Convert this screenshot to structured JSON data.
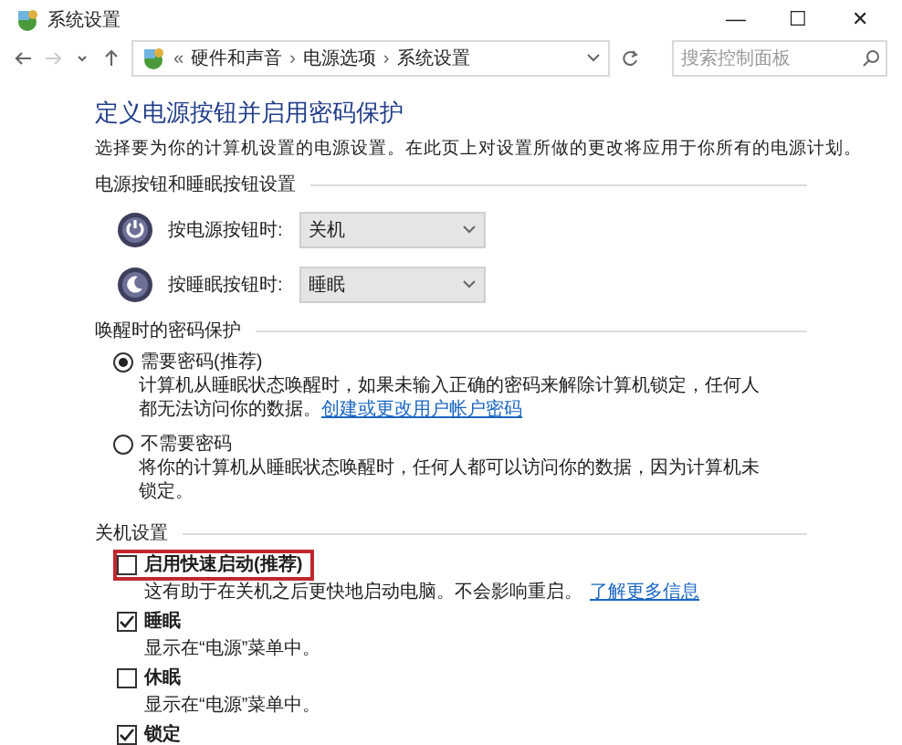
{
  "window": {
    "title": "系统设置",
    "controls": [
      "—",
      "☐",
      "✕"
    ]
  },
  "address_bar": {
    "overflow": "«",
    "crumbs": [
      "硬件和声音",
      "电源选项",
      "系统设置"
    ],
    "separator": "›"
  },
  "search": {
    "placeholder": "搜索控制面板"
  },
  "heading": "定义电源按钮并启用密码保护",
  "description": "选择要为你的计算机设置的电源设置。在此页上对设置所做的更改将应用于你所有的电源计划。",
  "button_section": {
    "title": "电源按钮和睡眠按钮设置",
    "rows": [
      {
        "kind": "power",
        "label": "按电源按钮时:",
        "value": "关机"
      },
      {
        "kind": "sleep",
        "label": "按睡眠按钮时:",
        "value": "睡眠"
      }
    ]
  },
  "password_section": {
    "title": "唤醒时的密码保护",
    "options": [
      {
        "label": "需要密码(推荐)",
        "selected": true,
        "description": "计算机从睡眠状态唤醒时，如果未输入正确的密码来解除计算机锁定，任何人都无法访问你的数据。",
        "link": "创建或更改用户帐户密码"
      },
      {
        "label": "不需要密码",
        "selected": false,
        "description": "将你的计算机从睡眠状态唤醒时，任何人都可以访问你的数据，因为计算机未锁定。"
      }
    ]
  },
  "shutdown_section": {
    "title": "关机设置",
    "items": [
      {
        "label": "启用快速启动(推荐)",
        "checked": false,
        "highlighted": true,
        "description": "这有助于在关机之后更快地启动电脑。不会影响重启。",
        "link": "了解更多信息"
      },
      {
        "label": "睡眠",
        "checked": true,
        "highlighted": false,
        "description": "显示在“电源”菜单中。"
      },
      {
        "label": "休眠",
        "checked": false,
        "highlighted": false,
        "description": "显示在“电源”菜单中。"
      },
      {
        "label": "锁定",
        "checked": true,
        "highlighted": false
      }
    ]
  }
}
